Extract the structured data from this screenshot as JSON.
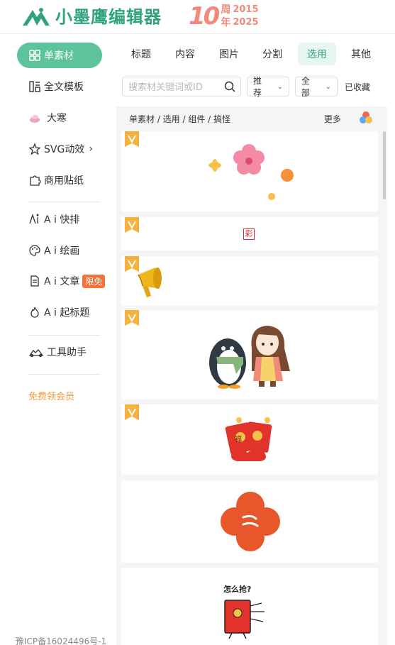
{
  "header": {
    "logo_text": "小墨鹰编辑器",
    "anniversary": {
      "number": "10",
      "char_top": "周",
      "char_bottom": "年",
      "year_start": "2015",
      "year_end": "2025"
    }
  },
  "sidebar": {
    "active_label": "单素材",
    "items": [
      {
        "label": "全文模板",
        "icon": "layout-icon"
      },
      {
        "label": "大寒",
        "icon": "snow-season-icon"
      },
      {
        "label": "SVG动效",
        "icon": "star-icon",
        "arrow": "›"
      },
      {
        "label": "商用贴纸",
        "icon": "puzzle-icon"
      },
      {
        "label": "A i 快排",
        "icon": "ai-icon"
      },
      {
        "label": "A i 绘画",
        "icon": "palette-icon"
      },
      {
        "label": "A i 文章",
        "icon": "document-icon",
        "tag": "限免"
      },
      {
        "label": "A i 起标题",
        "icon": "flame-icon"
      },
      {
        "label": "工具助手",
        "icon": "tools-icon"
      }
    ],
    "vip_label": "免费领会员",
    "icp": "豫ICP备16024496号-1"
  },
  "tabs": [
    "标题",
    "内容",
    "图片",
    "分割",
    "选用",
    "其他"
  ],
  "active_tab": "选用",
  "search": {
    "placeholder": "搜索材关键词或ID"
  },
  "filters": {
    "sort": "推荐",
    "scope": "全部",
    "favorites": "已收藏"
  },
  "breadcrumb": "单素材 / 选用 / 组件 / 搞怪",
  "more_label": "更多",
  "cards": {
    "stamp_char": "彩",
    "envelope_char": "福",
    "question_text": "怎么抢?"
  },
  "colors": {
    "brand": "#5cc39a",
    "brand_dark": "#2fa37a",
    "accent_orange": "#f5713a",
    "vip": "#f09a3a"
  }
}
